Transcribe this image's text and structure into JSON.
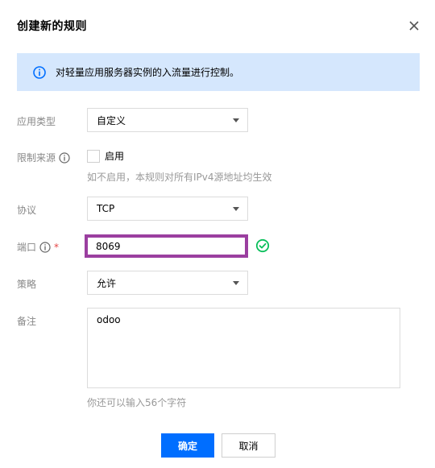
{
  "dialog": {
    "title": "创建新的规则",
    "notice": "对轻量应用服务器实例的入流量进行控制。"
  },
  "form": {
    "app_type": {
      "label": "应用类型",
      "value": "自定义"
    },
    "source": {
      "label": "限制来源",
      "checkbox_label": "启用",
      "checked": false,
      "hint": "如不启用，本规则对所有IPv4源地址均生效"
    },
    "protocol": {
      "label": "协议",
      "value": "TCP"
    },
    "port": {
      "label": "端口",
      "required_mark": "*",
      "value": "8069"
    },
    "policy": {
      "label": "策略",
      "value": "允许"
    },
    "remark": {
      "label": "备注",
      "value": "odoo",
      "hint": "你还可以输入56个字符"
    }
  },
  "buttons": {
    "confirm": "确定",
    "cancel": "取消"
  },
  "colors": {
    "primary": "#006eff",
    "notice_bg": "#d5e7fd",
    "success": "#0abf5b",
    "highlight": "#9b3fa0",
    "required": "#e54545"
  }
}
